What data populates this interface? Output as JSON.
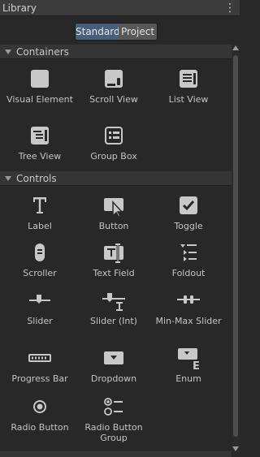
{
  "window": {
    "title": "Library"
  },
  "toggle": {
    "standard": "Standard",
    "project": "Project"
  },
  "sections": {
    "containers": {
      "label": "Containers",
      "items": [
        {
          "label": "Visual Element",
          "icon": "visual-element-icon"
        },
        {
          "label": "Scroll View",
          "icon": "scroll-view-icon"
        },
        {
          "label": "List View",
          "icon": "list-view-icon"
        },
        {
          "label": "Tree View",
          "icon": "tree-view-icon"
        },
        {
          "label": "Group Box",
          "icon": "group-box-icon"
        }
      ]
    },
    "controls": {
      "label": "Controls",
      "items": [
        {
          "label": "Label",
          "icon": "label-icon"
        },
        {
          "label": "Button",
          "icon": "button-icon"
        },
        {
          "label": "Toggle",
          "icon": "toggle-icon"
        },
        {
          "label": "Scroller",
          "icon": "scroller-icon"
        },
        {
          "label": "Text Field",
          "icon": "text-field-icon"
        },
        {
          "label": "Foldout",
          "icon": "foldout-icon"
        },
        {
          "label": "Slider",
          "icon": "slider-icon"
        },
        {
          "label": "Slider (Int)",
          "icon": "slider-int-icon"
        },
        {
          "label": "Min-Max Slider",
          "icon": "min-max-slider-icon"
        },
        {
          "label": "Progress Bar",
          "icon": "progress-bar-icon"
        },
        {
          "label": "Dropdown",
          "icon": "dropdown-icon"
        },
        {
          "label": "Enum",
          "icon": "enum-icon"
        },
        {
          "label": "Radio Button",
          "icon": "radio-button-icon"
        },
        {
          "label": "Radio Button Group",
          "icon": "radio-button-group-icon"
        }
      ]
    }
  },
  "colors": {
    "background": "#282828",
    "header": "#353535",
    "active_toggle": "#46607c",
    "icon": "#c8c8c8"
  }
}
